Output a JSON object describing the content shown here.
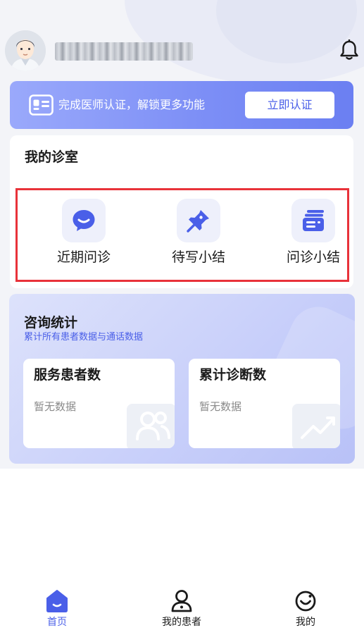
{
  "header": {
    "username": "██████████",
    "avatar_icon": "doctor-avatar",
    "bell_icon": "bell-icon"
  },
  "certification": {
    "text": "完成医师认证，解锁更多功能",
    "button_label": "立即认证",
    "icon": "id-card-icon"
  },
  "clinic": {
    "title": "我的诊室",
    "items": [
      {
        "label": "近期问诊",
        "icon": "chat-bubble-icon"
      },
      {
        "label": "待写小结",
        "icon": "pushpin-icon"
      },
      {
        "label": "问诊小结",
        "icon": "card-stack-icon"
      }
    ]
  },
  "stats": {
    "title": "咨询统计",
    "subtitle": "累计所有患者数据与通话数据",
    "cards": [
      {
        "title": "服务患者数",
        "value": "暂无数据",
        "icon": "patients-icon"
      },
      {
        "title": "累计诊断数",
        "value": "暂无数据",
        "icon": "trend-chart-icon"
      }
    ]
  },
  "bottom_nav": [
    {
      "label": "首页",
      "icon": "home-icon",
      "active": true
    },
    {
      "label": "我的患者",
      "icon": "user-icon",
      "active": false
    },
    {
      "label": "我的",
      "icon": "smile-icon",
      "active": false
    }
  ],
  "colors": {
    "accent": "#4a5fe8",
    "highlight_border": "#e8323a",
    "banner_start": "#9aa9fb",
    "banner_end": "#6b7ff2"
  }
}
